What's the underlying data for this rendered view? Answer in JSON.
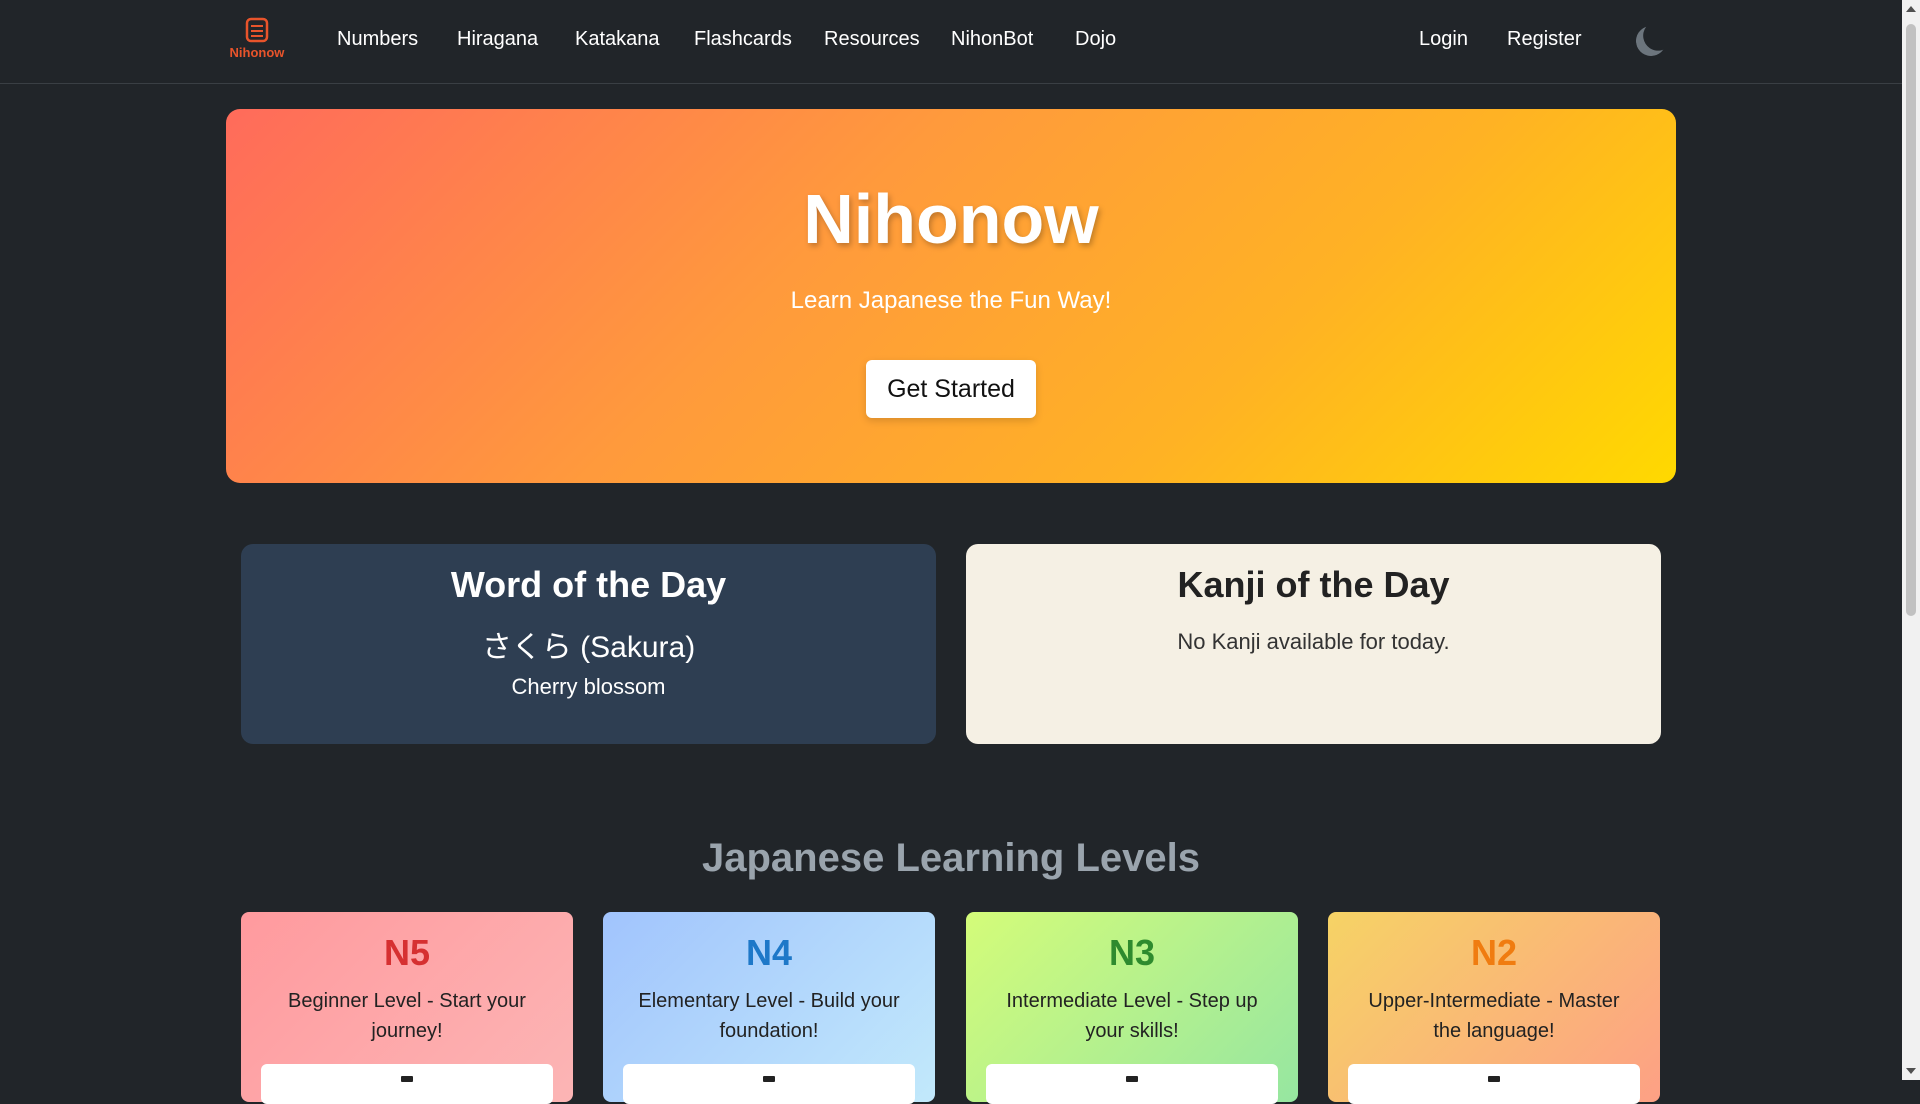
{
  "nav": {
    "brand": "Nihonow",
    "links": [
      "Numbers",
      "Hiragana",
      "Katakana",
      "Flashcards",
      "Resources",
      "NihonBot",
      "Dojo"
    ],
    "login": "Login",
    "register": "Register",
    "theme_toggle_icon": "moon-icon"
  },
  "hero": {
    "title": "Nihonow",
    "subtitle": "Learn Japanese the Fun Way!",
    "cta": "Get Started"
  },
  "word_of_day": {
    "title": "Word of the Day",
    "word": "さくら (Sakura)",
    "meaning": "Cherry blossom"
  },
  "kanji_of_day": {
    "title": "Kanji of the Day",
    "message": "No Kanji available for today."
  },
  "levels": {
    "heading": "Japanese Learning Levels",
    "items": [
      {
        "name": "N5",
        "desc": "Beginner Level - Start your journey!",
        "color": "#d63031"
      },
      {
        "name": "N4",
        "desc": "Elementary Level - Build your foundation!",
        "color": "#1e78c8"
      },
      {
        "name": "N3",
        "desc": "Intermediate Level - Step up your skills!",
        "color": "#2e8b2e"
      },
      {
        "name": "N2",
        "desc": "Upper-Intermediate - Master the language!",
        "color": "#f07c10"
      }
    ]
  },
  "colors": {
    "background": "#212529",
    "brand": "#e8542b",
    "hero_start": "#ff6b5b",
    "hero_end": "#ffd900"
  }
}
